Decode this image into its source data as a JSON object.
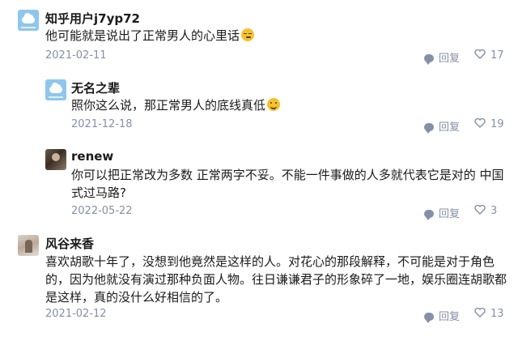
{
  "comments": [
    {
      "username": "知乎用户j7yp72",
      "text": "他可能就是说出了正常男人的心里话",
      "emoji": "sly-face",
      "date": "2021-02-11",
      "reply_label": "回复",
      "likes": "17"
    },
    {
      "username": "无名之辈",
      "text": "照你这么说，那正常男人的底线真低",
      "emoji": "smile-face",
      "date": "2021-12-18",
      "reply_label": "回复",
      "likes": "19"
    },
    {
      "username": "renew",
      "text_line1": "你可以把正常改为多数 正常两字不妥。不能一件事做的人多就代表它是对的 中国",
      "text_line2": "式过马路?",
      "date": "2022-05-22",
      "reply_label": "回复",
      "likes": "3"
    },
    {
      "username": "风谷来香",
      "text_line1": "喜欢胡歌十年了，没想到他竟然是这样的人。对花心的那段解释，不可能是对于角色",
      "text_line2": "的，因为他就没有演过那种负面人物。往日谦谦君子的形象碎了一地，娱乐圈连胡歌都",
      "text_line3": "是这样，真的没什么好相信的了。",
      "date": "2021-02-12",
      "reply_label": "回复",
      "likes": "13"
    }
  ],
  "icons": {
    "reply": "chat-bubble-icon",
    "like": "heart-icon"
  },
  "colors": {
    "meta": "#8590a6",
    "text": "#1a1a1a",
    "default_avatar": "#8fc6ec"
  }
}
